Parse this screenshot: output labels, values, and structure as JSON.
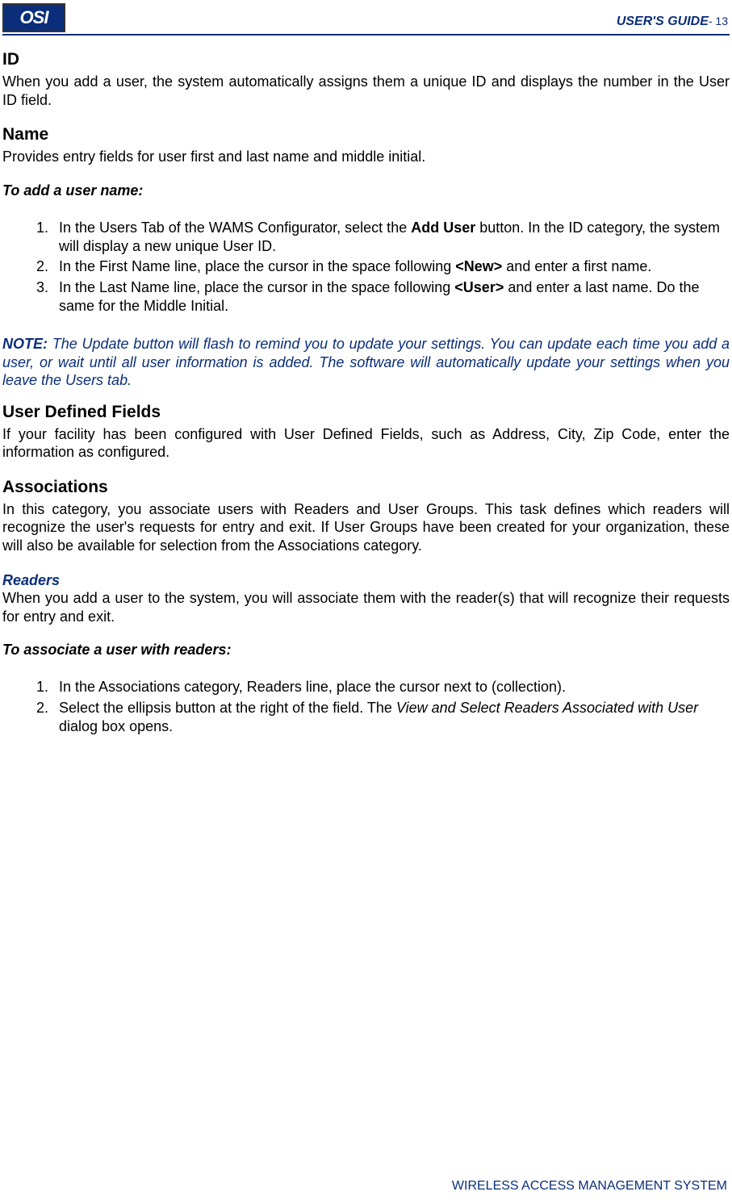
{
  "header": {
    "logo_text": "OSI",
    "guide_label": "USER'S GUIDE",
    "page_suffix": "- 13"
  },
  "sec_id": {
    "title": "ID",
    "body": "When you add a user, the system automatically assigns them a unique ID and displays the number in the User ID field."
  },
  "sec_name": {
    "title": "Name",
    "body": "Provides entry fields for user first and last name and middle initial.",
    "subhead": "To add a user name:",
    "step1_a": "In the Users Tab of the WAMS Configurator, select the ",
    "step1_bold": "Add User",
    "step1_b": " button.   In the ID category, the system will display a new unique User ID.",
    "step2_a": "In the First Name line, place the cursor in the space following ",
    "step2_bold": "<New>",
    "step2_b": " and enter a first name.",
    "step3_a": " In the Last Name line, place the cursor in the space following ",
    "step3_bold": "<User>",
    "step3_b": " and enter a last name. Do the same for the Middle Initial."
  },
  "note": {
    "label": "NOTE: ",
    "body": "The Update button will flash to remind you to update your settings.   You can update each time you add a user, or wait until all user information is added.    The software will automatically update your settings when you leave the Users tab."
  },
  "sec_udf": {
    "title": "User Defined Fields",
    "body": "If your facility has been configured with User Defined Fields, such as Address, City, Zip Code, enter the information as configured."
  },
  "sec_assoc": {
    "title": "Associations",
    "body": "In this category, you associate users with Readers and User Groups.   This task defines which readers will recognize the user's requests for entry and exit.   If User Groups have been created for your organization, these will also be available for selection from the Associations category."
  },
  "sec_readers": {
    "title": "Readers",
    "body": "When you add a user to the system, you will associate them with the reader(s) that will recognize their requests for entry and exit.",
    "subhead": "To associate a user with readers:",
    "step1": "In the Associations category, Readers line, place the cursor next to (collection).",
    "step2_a": "Select the ellipsis button at the right of the field.   The ",
    "step2_ital": "View and Select Readers Associated with User",
    "step2_b": " dialog box opens."
  },
  "footer": {
    "text": "WIRELESS ACCESS MANAGEMENT SYSTEM"
  }
}
